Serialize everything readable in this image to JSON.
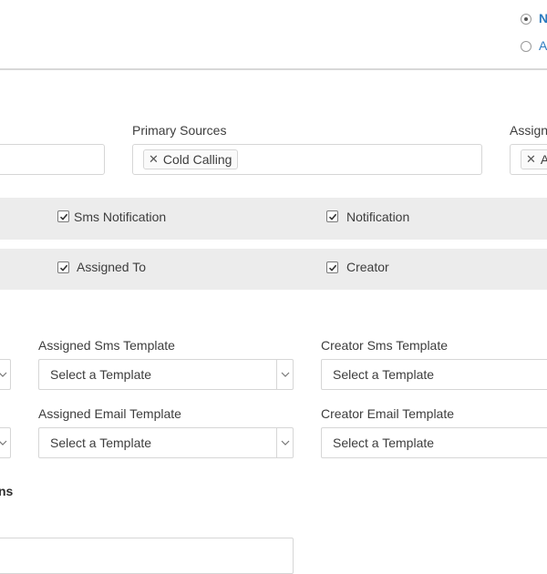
{
  "header": {
    "radio_options": [
      {
        "label": "N",
        "checked": true
      },
      {
        "label": "A",
        "checked": false
      }
    ]
  },
  "sources": {
    "primary_label": "Primary Sources",
    "primary_tags": [
      "Cold Calling"
    ],
    "assign_label": "Assign",
    "assign_tags": [
      "A"
    ]
  },
  "notifications": {
    "row1": [
      "Sms Notification",
      "Notification"
    ],
    "row2": [
      "Assigned To",
      "Creator"
    ]
  },
  "templates": {
    "assigned_sms_label": "Assigned Sms Template",
    "assigned_sms_value": "Select a Template",
    "creator_sms_label": "Creator Sms Template",
    "creator_sms_value": "Select a Template",
    "assigned_email_label": "Assigned Email Template",
    "assigned_email_value": "Select a Template",
    "creator_email_label": "Creator Email Template",
    "creator_email_value": "Select a Template"
  },
  "section": {
    "partial_title": "ns"
  },
  "colors": {
    "accent": "#2b7bbf",
    "band": "#ececec",
    "border": "#d6d6d6"
  }
}
